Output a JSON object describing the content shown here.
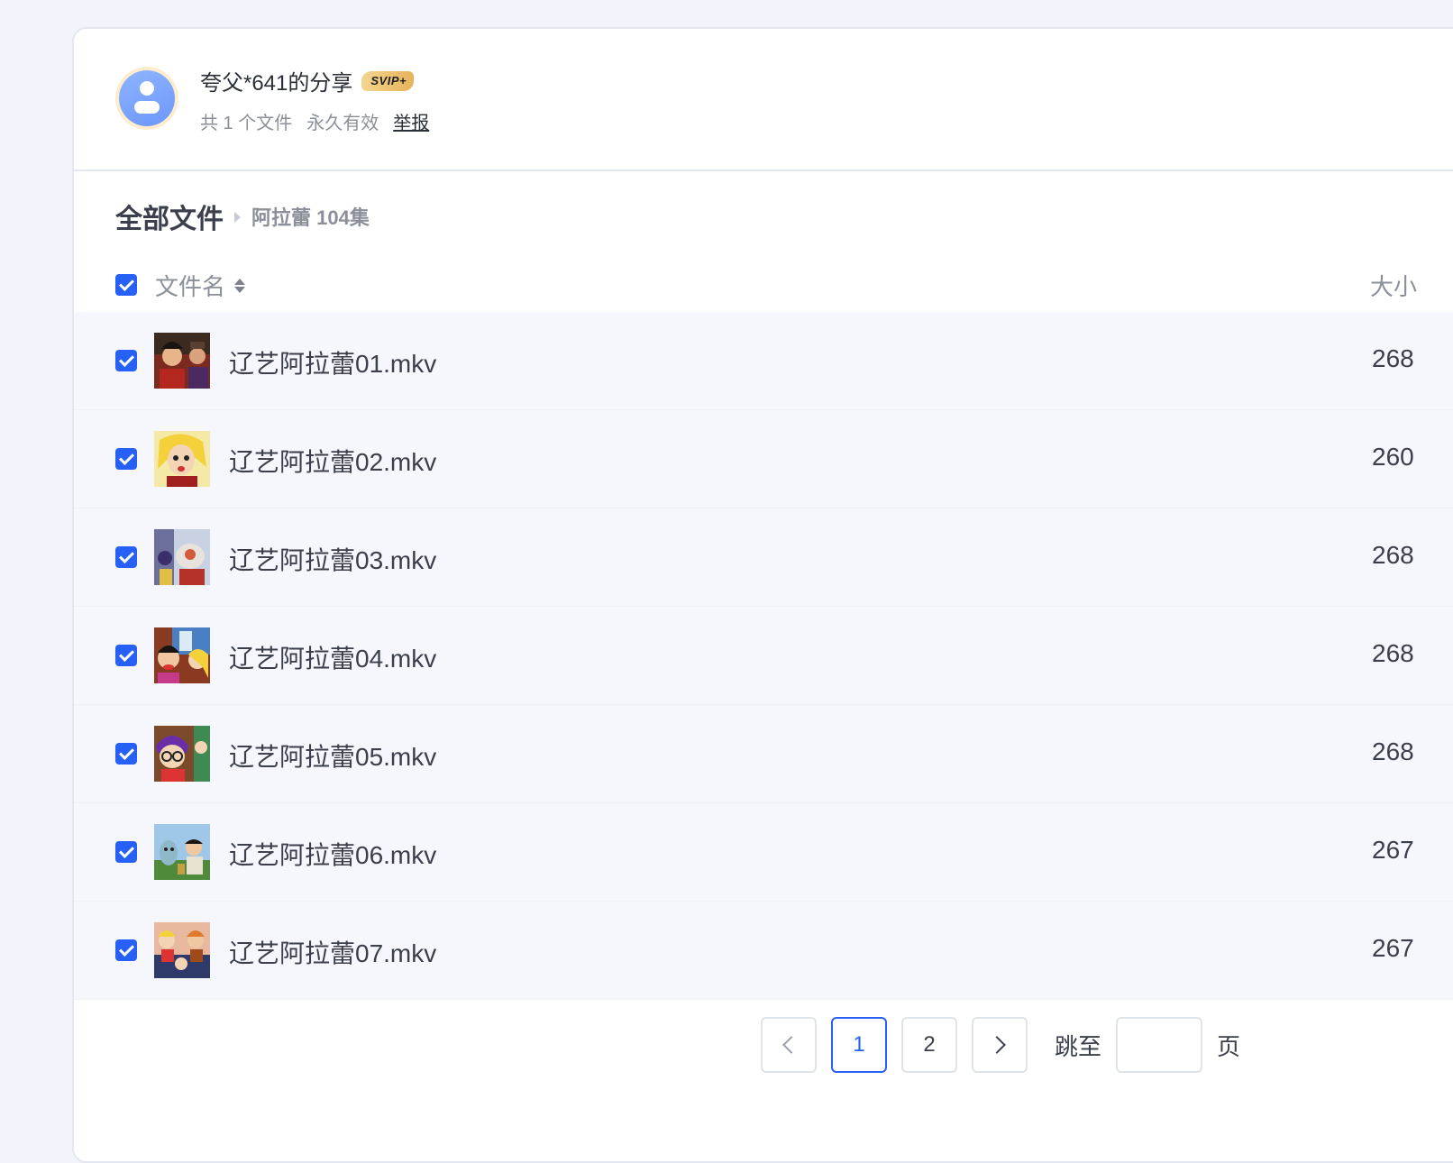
{
  "share": {
    "title": "夸父*641的分享",
    "badge": "SVIP+",
    "file_count": "共 1 个文件",
    "validity": "永久有效",
    "report_label": "举报"
  },
  "breadcrumb": {
    "root": "全部文件",
    "current": "阿拉蕾 104集"
  },
  "table": {
    "header_name": "文件名",
    "header_size": "大小",
    "rows": [
      {
        "name": "辽艺阿拉蕾01.mkv",
        "size": "268",
        "checked": true
      },
      {
        "name": "辽艺阿拉蕾02.mkv",
        "size": "260",
        "checked": true
      },
      {
        "name": "辽艺阿拉蕾03.mkv",
        "size": "268",
        "checked": true
      },
      {
        "name": "辽艺阿拉蕾04.mkv",
        "size": "268",
        "checked": true
      },
      {
        "name": "辽艺阿拉蕾05.mkv",
        "size": "268",
        "checked": true
      },
      {
        "name": "辽艺阿拉蕾06.mkv",
        "size": "267",
        "checked": true
      },
      {
        "name": "辽艺阿拉蕾07.mkv",
        "size": "267",
        "checked": true
      }
    ]
  },
  "pagination": {
    "pages": [
      "1",
      "2"
    ],
    "current_page": "1",
    "jump_label": "跳至",
    "jump_value": "",
    "page_unit": "页"
  },
  "colors": {
    "accent": "#2660f5",
    "background": "#f1f4fb",
    "row_background": "#f5f7fd"
  }
}
